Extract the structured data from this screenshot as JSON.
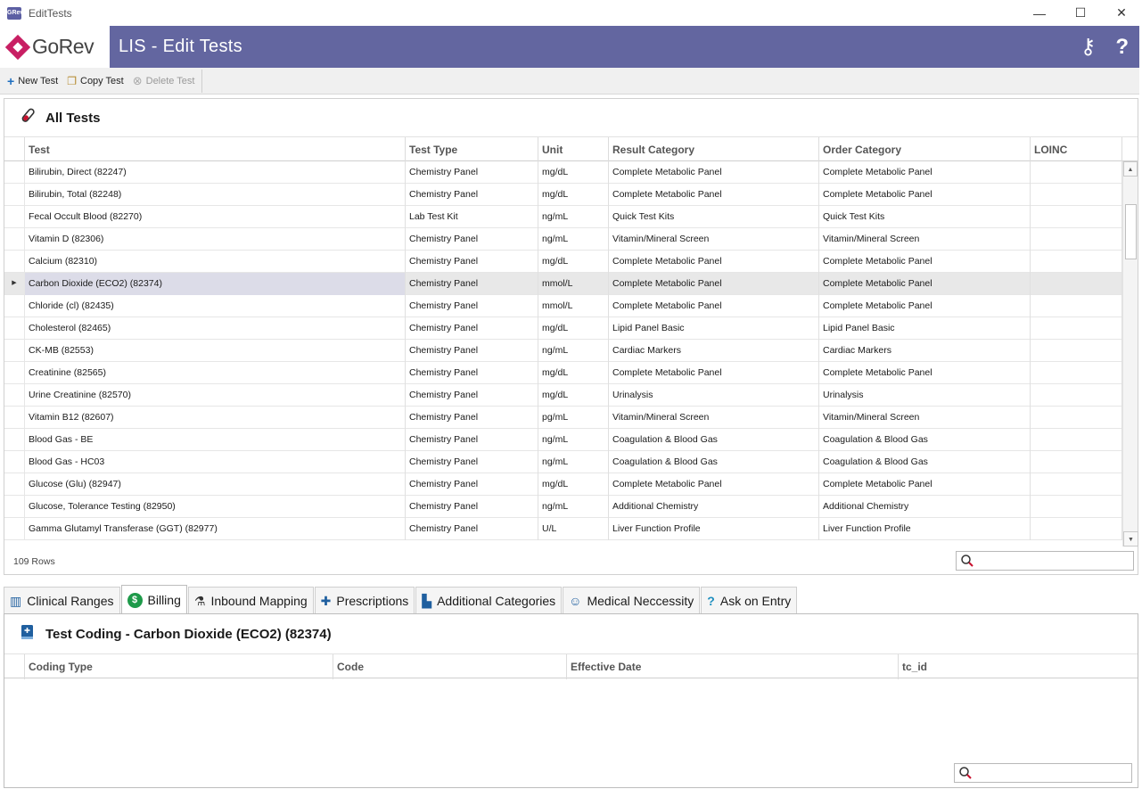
{
  "window": {
    "app_icon_text": "GRev",
    "title": "EditTests",
    "minimize": "—",
    "maximize": "☐",
    "close": "✕"
  },
  "banner": {
    "logo_text": "GoRev",
    "title": "LIS - Edit Tests",
    "keys_icon": "⚷",
    "help_icon": "?"
  },
  "toolbar": {
    "new_test": "New Test",
    "copy_test": "Copy Test",
    "delete_test": "Delete Test"
  },
  "all_tests": {
    "title": "All Tests",
    "columns": [
      "Test",
      "Test Type",
      "Unit",
      "Result Category",
      "Order Category",
      "LOINC"
    ],
    "rows": [
      [
        "Bilirubin, Direct (82247)",
        "Chemistry Panel",
        "mg/dL",
        "Complete Metabolic Panel",
        "Complete Metabolic Panel",
        ""
      ],
      [
        "Bilirubin, Total (82248)",
        "Chemistry Panel",
        "mg/dL",
        "Complete Metabolic Panel",
        "Complete Metabolic Panel",
        ""
      ],
      [
        "Fecal Occult Blood (82270)",
        "Lab Test Kit",
        "ng/mL",
        "Quick Test Kits",
        "Quick Test Kits",
        ""
      ],
      [
        "Vitamin D (82306)",
        "Chemistry Panel",
        "ng/mL",
        "Vitamin/Mineral Screen",
        "Vitamin/Mineral Screen",
        ""
      ],
      [
        "Calcium (82310)",
        "Chemistry Panel",
        "mg/dL",
        "Complete Metabolic Panel",
        "Complete Metabolic Panel",
        ""
      ],
      [
        "Carbon Dioxide (ECO2) (82374)",
        "Chemistry Panel",
        "mmol/L",
        "Complete Metabolic Panel",
        "Complete Metabolic Panel",
        ""
      ],
      [
        "Chloride (cl) (82435)",
        "Chemistry Panel",
        "mmol/L",
        "Complete Metabolic Panel",
        "Complete Metabolic Panel",
        ""
      ],
      [
        "Cholesterol (82465)",
        "Chemistry Panel",
        "mg/dL",
        "Lipid Panel Basic",
        "Lipid Panel Basic",
        ""
      ],
      [
        "CK-MB (82553)",
        "Chemistry Panel",
        "ng/mL",
        "Cardiac Markers",
        "Cardiac Markers",
        ""
      ],
      [
        "Creatinine (82565)",
        "Chemistry Panel",
        "mg/dL",
        "Complete Metabolic Panel",
        "Complete Metabolic Panel",
        ""
      ],
      [
        "Urine Creatinine (82570)",
        "Chemistry Panel",
        "mg/dL",
        "Urinalysis",
        "Urinalysis",
        ""
      ],
      [
        "Vitamin B12 (82607)",
        "Chemistry Panel",
        "pg/mL",
        "Vitamin/Mineral Screen",
        "Vitamin/Mineral Screen",
        ""
      ],
      [
        "Blood Gas - BE",
        "Chemistry Panel",
        "ng/mL",
        "Coagulation & Blood Gas",
        "Coagulation & Blood Gas",
        ""
      ],
      [
        "Blood Gas - HC03",
        "Chemistry Panel",
        "ng/mL",
        "Coagulation & Blood Gas",
        "Coagulation & Blood Gas",
        ""
      ],
      [
        "Glucose (Glu) (82947)",
        "Chemistry Panel",
        "mg/dL",
        "Complete Metabolic Panel",
        "Complete Metabolic Panel",
        ""
      ],
      [
        "Glucose, Tolerance Testing (82950)",
        "Chemistry Panel",
        "ng/mL",
        "Additional Chemistry",
        "Additional Chemistry",
        ""
      ],
      [
        "Gamma Glutamyl Transferase (GGT) (82977)",
        "Chemistry Panel",
        "U/L",
        "Liver Function Profile",
        "Liver Function Profile",
        ""
      ]
    ],
    "selected_index": 5,
    "row_count": "109 Rows",
    "search_value": ""
  },
  "tabs": [
    {
      "label": "Clinical Ranges",
      "icon": "▥",
      "active": false
    },
    {
      "label": "Billing",
      "icon": "$",
      "active": true
    },
    {
      "label": "Inbound Mapping",
      "icon": "⚗",
      "active": false
    },
    {
      "label": "Prescriptions",
      "icon": "✚",
      "active": false
    },
    {
      "label": "Additional Categories",
      "icon": "▙",
      "active": false
    },
    {
      "label": "Medical Neccessity",
      "icon": "☺",
      "active": false
    },
    {
      "label": "Ask on Entry",
      "icon": "?",
      "active": false
    }
  ],
  "test_coding": {
    "title": "Test Coding - Carbon Dioxide (ECO2) (82374)",
    "columns": [
      "Coding Type",
      "Code",
      "Effective Date",
      "tc_id"
    ],
    "search_value": ""
  },
  "colors": {
    "banner": "#6366a0",
    "logo_accent": "#c81f63",
    "billing_icon": "#1e9a4a"
  }
}
